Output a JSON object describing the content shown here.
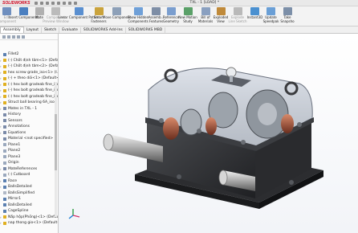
{
  "app": {
    "logo": "SOLIDWORKS",
    "title": "TXL - 1 [LOAD] *"
  },
  "ribbon": [
    {
      "label": "Edit\nComponent",
      "color": "#6f8fbf",
      "disabled": true
    },
    {
      "label": "Insert Components",
      "color": "#4a7fc0",
      "disabled": false
    },
    {
      "label": "Mate",
      "color": "#b0b0b0",
      "disabled": false
    },
    {
      "label": "Component\nPreview Window",
      "color": "#bbbbbb",
      "disabled": true
    },
    {
      "label": "Linear Component Pattern",
      "color": "#5a8fd0",
      "disabled": false
    },
    {
      "label": "Smart\nFasteners",
      "color": "#caa33c",
      "disabled": false
    },
    {
      "label": "Move Component",
      "color": "#8da0b8",
      "disabled": false
    },
    {
      "label": "Show Hidden\nComponents",
      "color": "#6fa0d8",
      "disabled": false
    },
    {
      "label": "Assemb...\nFeatures",
      "color": "#7e8ea6",
      "disabled": false
    },
    {
      "label": "Reference\nGeometry",
      "color": "#7a9ecf",
      "disabled": false
    },
    {
      "label": "New Motion\nStudy",
      "color": "#5aa068",
      "disabled": false
    },
    {
      "label": "Bill of\nMaterials",
      "color": "#8aa0c0",
      "disabled": false
    },
    {
      "label": "Exploded\nView",
      "color": "#c08a3a",
      "disabled": false
    },
    {
      "label": "Explode\nLine Sketch",
      "color": "#b9b9b9",
      "disabled": true
    },
    {
      "label": "Instant3D",
      "color": "#4a90d0",
      "disabled": false
    },
    {
      "label": "Update\nSpeedpak",
      "color": "#6a9fd6",
      "disabled": false
    },
    {
      "label": "Take\nSnapsho",
      "color": "#7c8fa8",
      "disabled": false
    }
  ],
  "tabs": [
    {
      "label": "Assembly",
      "active": true
    },
    {
      "label": "Layout",
      "active": false
    },
    {
      "label": "Sketch",
      "active": false
    },
    {
      "label": "Evaluate",
      "active": false
    },
    {
      "label": "SOLIDWORKS Add-Ins",
      "active": false
    },
    {
      "label": "SOLIDWORKS MBD",
      "active": false
    }
  ],
  "tree": [
    {
      "text": "Fillet2",
      "icon": "#5a7fb0",
      "exp": ""
    },
    {
      "text": "(-) Chốt định tâm<1> (Defa...",
      "icon": "#e0b020",
      "exp": "›"
    },
    {
      "text": "(-) Chốt định tâm<2> (Defau...",
      "icon": "#e0b020",
      "exp": "›"
    },
    {
      "text": "hex screw grade_iso<1> (I...",
      "icon": "#e0b020",
      "exp": "›"
    },
    {
      "text": "(-) + theo dõi<1> (Default<...",
      "icon": "#e0b020",
      "exp": "›"
    },
    {
      "text": "(-) hex bolt gradeab fine_iso",
      "icon": "#e0b020",
      "exp": "›"
    },
    {
      "text": "(-) hex bolt gradeab fine_iso",
      "icon": "#e0b020",
      "exp": "›"
    },
    {
      "text": "(-) hex bolt gradeab fine_iso",
      "icon": "#e0b020",
      "exp": "›"
    },
    {
      "text": "Struct ball bearing 6A_iso",
      "icon": "#e0b020",
      "exp": "›"
    },
    {
      "text": "Mates in TXL - 1",
      "icon": "#7a8aa8",
      "exp": "›"
    },
    {
      "text": "History",
      "icon": "#7a8aa8",
      "exp": ""
    },
    {
      "text": "Sensors",
      "icon": "#7a8aa8",
      "exp": ""
    },
    {
      "text": "Annotations",
      "icon": "#7a8aa8",
      "exp": "›"
    },
    {
      "text": "Equations",
      "icon": "#7a8aa8",
      "exp": "›"
    },
    {
      "text": "Material <not specified>",
      "icon": "#7a8aa8",
      "exp": ""
    },
    {
      "text": "Plane1",
      "icon": "#9aa8bd",
      "exp": ""
    },
    {
      "text": "Plane2",
      "icon": "#9aa8bd",
      "exp": ""
    },
    {
      "text": "Plane3",
      "icon": "#9aa8bd",
      "exp": ""
    },
    {
      "text": "Origin",
      "icon": "#9aa8bd",
      "exp": ""
    },
    {
      "text": "MateReferences",
      "icon": "#7a8aa8",
      "exp": "›"
    },
    {
      "text": "(-) Cutboard",
      "icon": "#9aa8bd",
      "exp": ""
    },
    {
      "text": "Race",
      "icon": "#5a7fb0",
      "exp": "›"
    },
    {
      "text": "BallsDetailed",
      "icon": "#5a7fb0",
      "exp": "›"
    },
    {
      "text": "BallsSimplified",
      "icon": "#b0b8c6",
      "exp": ""
    },
    {
      "text": "Mirror1",
      "icon": "#5a7fb0",
      "exp": ""
    },
    {
      "text": "BallsDetailed",
      "icon": "#5a7fb0",
      "exp": ""
    },
    {
      "text": "CageSpline",
      "icon": "#5a7fb0",
      "exp": ""
    },
    {
      "text": "Nắp hộp(Phồng)<1> (Defau",
      "icon": "#e0b020",
      "exp": "›"
    },
    {
      "text": "nap thong gio<1> (Default<",
      "icon": "#e0b020",
      "exp": "›"
    }
  ]
}
